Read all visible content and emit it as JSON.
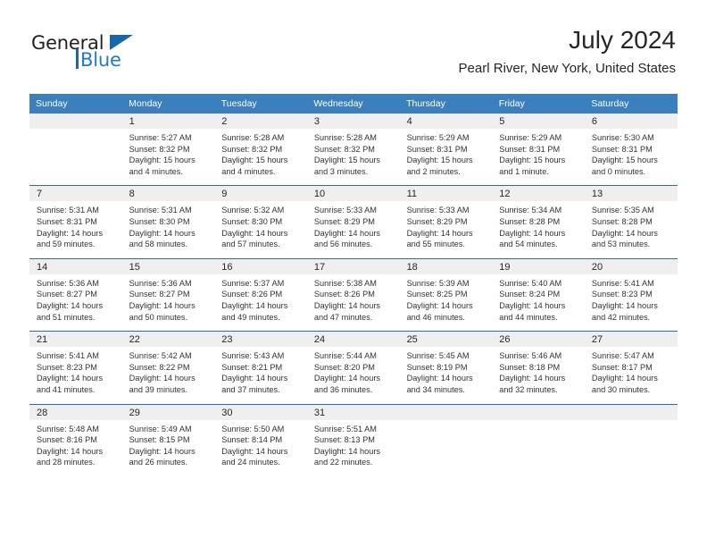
{
  "brand": {
    "name_part1": "General",
    "name_part2": "Blue",
    "triangle_icon": "triangle-icon",
    "accent_color": "#1668ab"
  },
  "header": {
    "title": "July 2024",
    "subtitle": "Pearl River, New York, United States"
  },
  "colors": {
    "header_row_bg": "#3c7fbe",
    "daynum_bg": "#efefef",
    "row_divider": "#2e6da4",
    "text": "#333333"
  },
  "weekdays": [
    "Sunday",
    "Monday",
    "Tuesday",
    "Wednesday",
    "Thursday",
    "Friday",
    "Saturday"
  ],
  "weeks": [
    [
      {
        "day": "",
        "sunrise": "",
        "sunset": "",
        "daylight": "",
        "daylight2": ""
      },
      {
        "day": "1",
        "sunrise": "Sunrise: 5:27 AM",
        "sunset": "Sunset: 8:32 PM",
        "daylight": "Daylight: 15 hours",
        "daylight2": "and 4 minutes."
      },
      {
        "day": "2",
        "sunrise": "Sunrise: 5:28 AM",
        "sunset": "Sunset: 8:32 PM",
        "daylight": "Daylight: 15 hours",
        "daylight2": "and 4 minutes."
      },
      {
        "day": "3",
        "sunrise": "Sunrise: 5:28 AM",
        "sunset": "Sunset: 8:32 PM",
        "daylight": "Daylight: 15 hours",
        "daylight2": "and 3 minutes."
      },
      {
        "day": "4",
        "sunrise": "Sunrise: 5:29 AM",
        "sunset": "Sunset: 8:31 PM",
        "daylight": "Daylight: 15 hours",
        "daylight2": "and 2 minutes."
      },
      {
        "day": "5",
        "sunrise": "Sunrise: 5:29 AM",
        "sunset": "Sunset: 8:31 PM",
        "daylight": "Daylight: 15 hours",
        "daylight2": "and 1 minute."
      },
      {
        "day": "6",
        "sunrise": "Sunrise: 5:30 AM",
        "sunset": "Sunset: 8:31 PM",
        "daylight": "Daylight: 15 hours",
        "daylight2": "and 0 minutes."
      }
    ],
    [
      {
        "day": "7",
        "sunrise": "Sunrise: 5:31 AM",
        "sunset": "Sunset: 8:31 PM",
        "daylight": "Daylight: 14 hours",
        "daylight2": "and 59 minutes."
      },
      {
        "day": "8",
        "sunrise": "Sunrise: 5:31 AM",
        "sunset": "Sunset: 8:30 PM",
        "daylight": "Daylight: 14 hours",
        "daylight2": "and 58 minutes."
      },
      {
        "day": "9",
        "sunrise": "Sunrise: 5:32 AM",
        "sunset": "Sunset: 8:30 PM",
        "daylight": "Daylight: 14 hours",
        "daylight2": "and 57 minutes."
      },
      {
        "day": "10",
        "sunrise": "Sunrise: 5:33 AM",
        "sunset": "Sunset: 8:29 PM",
        "daylight": "Daylight: 14 hours",
        "daylight2": "and 56 minutes."
      },
      {
        "day": "11",
        "sunrise": "Sunrise: 5:33 AM",
        "sunset": "Sunset: 8:29 PM",
        "daylight": "Daylight: 14 hours",
        "daylight2": "and 55 minutes."
      },
      {
        "day": "12",
        "sunrise": "Sunrise: 5:34 AM",
        "sunset": "Sunset: 8:28 PM",
        "daylight": "Daylight: 14 hours",
        "daylight2": "and 54 minutes."
      },
      {
        "day": "13",
        "sunrise": "Sunrise: 5:35 AM",
        "sunset": "Sunset: 8:28 PM",
        "daylight": "Daylight: 14 hours",
        "daylight2": "and 53 minutes."
      }
    ],
    [
      {
        "day": "14",
        "sunrise": "Sunrise: 5:36 AM",
        "sunset": "Sunset: 8:27 PM",
        "daylight": "Daylight: 14 hours",
        "daylight2": "and 51 minutes."
      },
      {
        "day": "15",
        "sunrise": "Sunrise: 5:36 AM",
        "sunset": "Sunset: 8:27 PM",
        "daylight": "Daylight: 14 hours",
        "daylight2": "and 50 minutes."
      },
      {
        "day": "16",
        "sunrise": "Sunrise: 5:37 AM",
        "sunset": "Sunset: 8:26 PM",
        "daylight": "Daylight: 14 hours",
        "daylight2": "and 49 minutes."
      },
      {
        "day": "17",
        "sunrise": "Sunrise: 5:38 AM",
        "sunset": "Sunset: 8:26 PM",
        "daylight": "Daylight: 14 hours",
        "daylight2": "and 47 minutes."
      },
      {
        "day": "18",
        "sunrise": "Sunrise: 5:39 AM",
        "sunset": "Sunset: 8:25 PM",
        "daylight": "Daylight: 14 hours",
        "daylight2": "and 46 minutes."
      },
      {
        "day": "19",
        "sunrise": "Sunrise: 5:40 AM",
        "sunset": "Sunset: 8:24 PM",
        "daylight": "Daylight: 14 hours",
        "daylight2": "and 44 minutes."
      },
      {
        "day": "20",
        "sunrise": "Sunrise: 5:41 AM",
        "sunset": "Sunset: 8:23 PM",
        "daylight": "Daylight: 14 hours",
        "daylight2": "and 42 minutes."
      }
    ],
    [
      {
        "day": "21",
        "sunrise": "Sunrise: 5:41 AM",
        "sunset": "Sunset: 8:23 PM",
        "daylight": "Daylight: 14 hours",
        "daylight2": "and 41 minutes."
      },
      {
        "day": "22",
        "sunrise": "Sunrise: 5:42 AM",
        "sunset": "Sunset: 8:22 PM",
        "daylight": "Daylight: 14 hours",
        "daylight2": "and 39 minutes."
      },
      {
        "day": "23",
        "sunrise": "Sunrise: 5:43 AM",
        "sunset": "Sunset: 8:21 PM",
        "daylight": "Daylight: 14 hours",
        "daylight2": "and 37 minutes."
      },
      {
        "day": "24",
        "sunrise": "Sunrise: 5:44 AM",
        "sunset": "Sunset: 8:20 PM",
        "daylight": "Daylight: 14 hours",
        "daylight2": "and 36 minutes."
      },
      {
        "day": "25",
        "sunrise": "Sunrise: 5:45 AM",
        "sunset": "Sunset: 8:19 PM",
        "daylight": "Daylight: 14 hours",
        "daylight2": "and 34 minutes."
      },
      {
        "day": "26",
        "sunrise": "Sunrise: 5:46 AM",
        "sunset": "Sunset: 8:18 PM",
        "daylight": "Daylight: 14 hours",
        "daylight2": "and 32 minutes."
      },
      {
        "day": "27",
        "sunrise": "Sunrise: 5:47 AM",
        "sunset": "Sunset: 8:17 PM",
        "daylight": "Daylight: 14 hours",
        "daylight2": "and 30 minutes."
      }
    ],
    [
      {
        "day": "28",
        "sunrise": "Sunrise: 5:48 AM",
        "sunset": "Sunset: 8:16 PM",
        "daylight": "Daylight: 14 hours",
        "daylight2": "and 28 minutes."
      },
      {
        "day": "29",
        "sunrise": "Sunrise: 5:49 AM",
        "sunset": "Sunset: 8:15 PM",
        "daylight": "Daylight: 14 hours",
        "daylight2": "and 26 minutes."
      },
      {
        "day": "30",
        "sunrise": "Sunrise: 5:50 AM",
        "sunset": "Sunset: 8:14 PM",
        "daylight": "Daylight: 14 hours",
        "daylight2": "and 24 minutes."
      },
      {
        "day": "31",
        "sunrise": "Sunrise: 5:51 AM",
        "sunset": "Sunset: 8:13 PM",
        "daylight": "Daylight: 14 hours",
        "daylight2": "and 22 minutes."
      },
      {
        "day": "",
        "sunrise": "",
        "sunset": "",
        "daylight": "",
        "daylight2": ""
      },
      {
        "day": "",
        "sunrise": "",
        "sunset": "",
        "daylight": "",
        "daylight2": ""
      },
      {
        "day": "",
        "sunrise": "",
        "sunset": "",
        "daylight": "",
        "daylight2": ""
      }
    ]
  ]
}
